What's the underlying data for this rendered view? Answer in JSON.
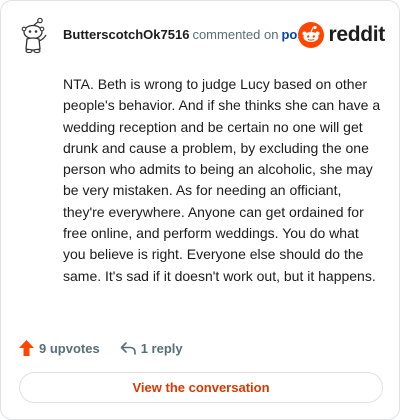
{
  "header": {
    "username": "ButterscotchOk7516",
    "verb": "commented on",
    "link_text": "post",
    "brand": "reddit"
  },
  "comment": {
    "text": "NTA. Beth is wrong to judge Lucy based on other people's behavior. And if she thinks she can have a wedding reception and be certain no one will get drunk and cause a problem, by excluding the one person who admits to being an alcoholic, she may be very mistaken. As for needing an officiant, they're everywhere. Anyone can get ordained for free online, and perform weddings. You do what you believe is right. Everyone else should do the same. It's sad if it doesn't work out, but it happens."
  },
  "actions": {
    "upvotes_label": "9 upvotes",
    "reply_label": "1 reply"
  },
  "cta": {
    "label": "View the conversation"
  },
  "colors": {
    "brand": "#ff4500",
    "upvote": "#ff4500",
    "link": "#0045ac",
    "cta_text": "#d93900",
    "muted": "#576f76"
  },
  "icons": [
    "snoo-avatar-icon",
    "reddit-logo-icon",
    "upvote-arrow-icon",
    "reply-arrow-icon"
  ]
}
